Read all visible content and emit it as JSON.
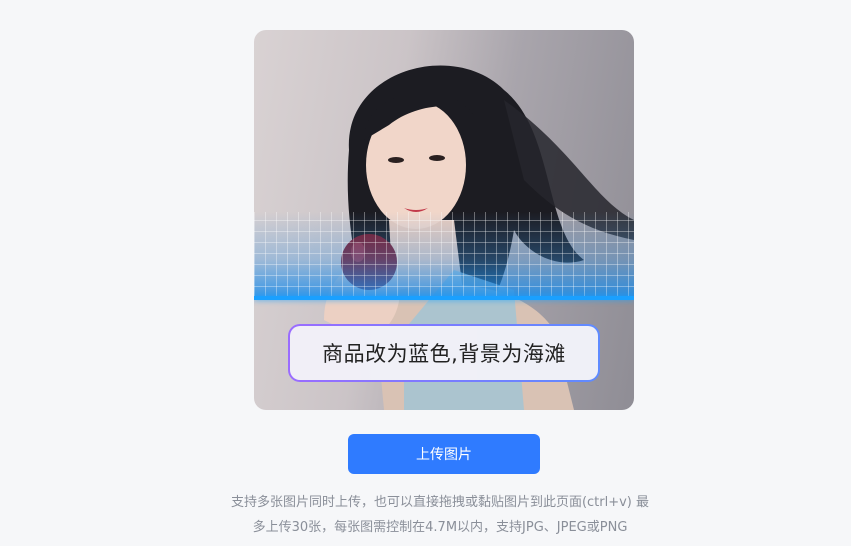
{
  "preview": {
    "image_alt": "woman holding red apple",
    "prompt_text": "商品改为蓝色,背景为海滩"
  },
  "actions": {
    "upload_label": "上传图片"
  },
  "hint": {
    "line1": "支持多张图片同时上传，也可以直接拖拽或黏贴图片到此页面(ctrl+v) 最",
    "line2": "多上传30张，每张图需控制在4.7M以内，支持JPG、JPEG或PNG"
  },
  "colors": {
    "accent": "#2f7bff",
    "scan": "#1aa0ff",
    "background": "#f6f7f9"
  }
}
